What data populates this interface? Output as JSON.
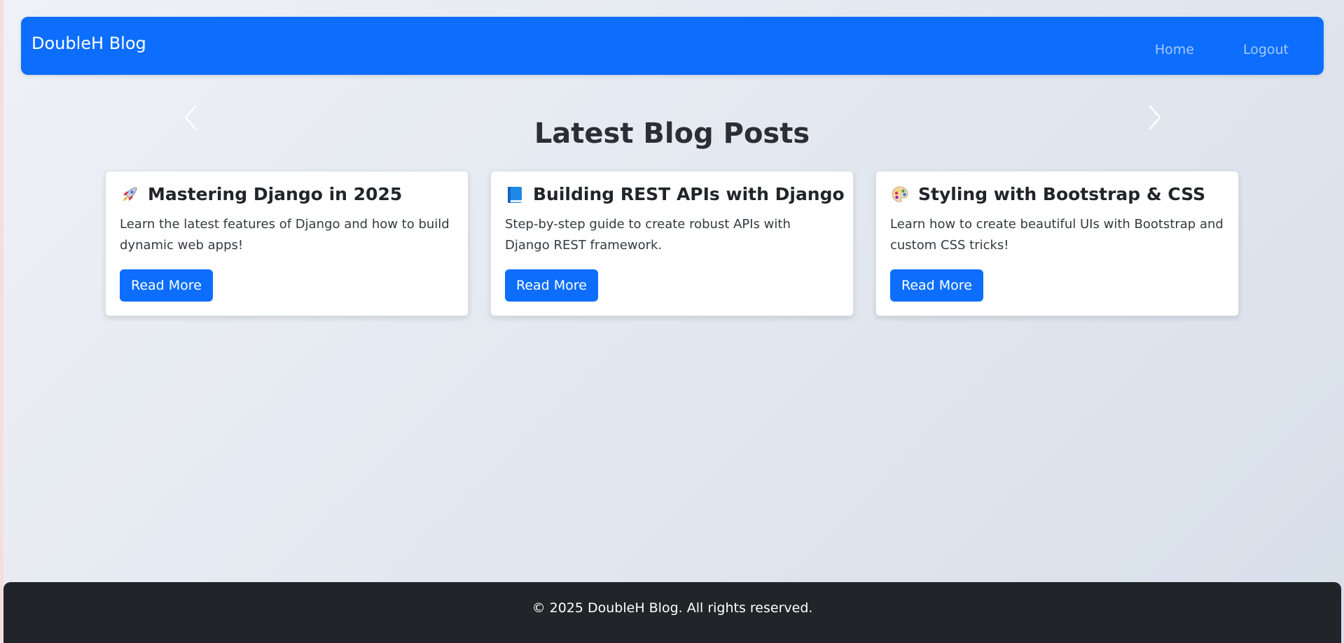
{
  "navbar": {
    "brand": "DoubleH Blog",
    "links": [
      {
        "label": "Home"
      },
      {
        "label": "Logout"
      }
    ]
  },
  "main": {
    "title": "Latest Blog Posts",
    "posts": [
      {
        "icon": "rocket-icon",
        "title": "Mastering Django in 2025",
        "excerpt": "Learn the latest features of Django and how to build dynamic web apps!",
        "button": "Read More"
      },
      {
        "icon": "blue-book-icon",
        "title": "Building REST APIs with Django",
        "excerpt": "Step-by-step guide to create robust APIs with Django REST framework.",
        "button": "Read More"
      },
      {
        "icon": "palette-icon",
        "title": "Styling with Bootstrap & CSS",
        "excerpt": "Learn how to create beautiful UIs with Bootstrap and custom CSS tricks!",
        "button": "Read More"
      }
    ]
  },
  "footer": {
    "text": "© 2025 DoubleH Blog. All rights reserved."
  },
  "colors": {
    "primary": "#0d6efd",
    "footer_bg": "#212529",
    "text": "#212529"
  }
}
